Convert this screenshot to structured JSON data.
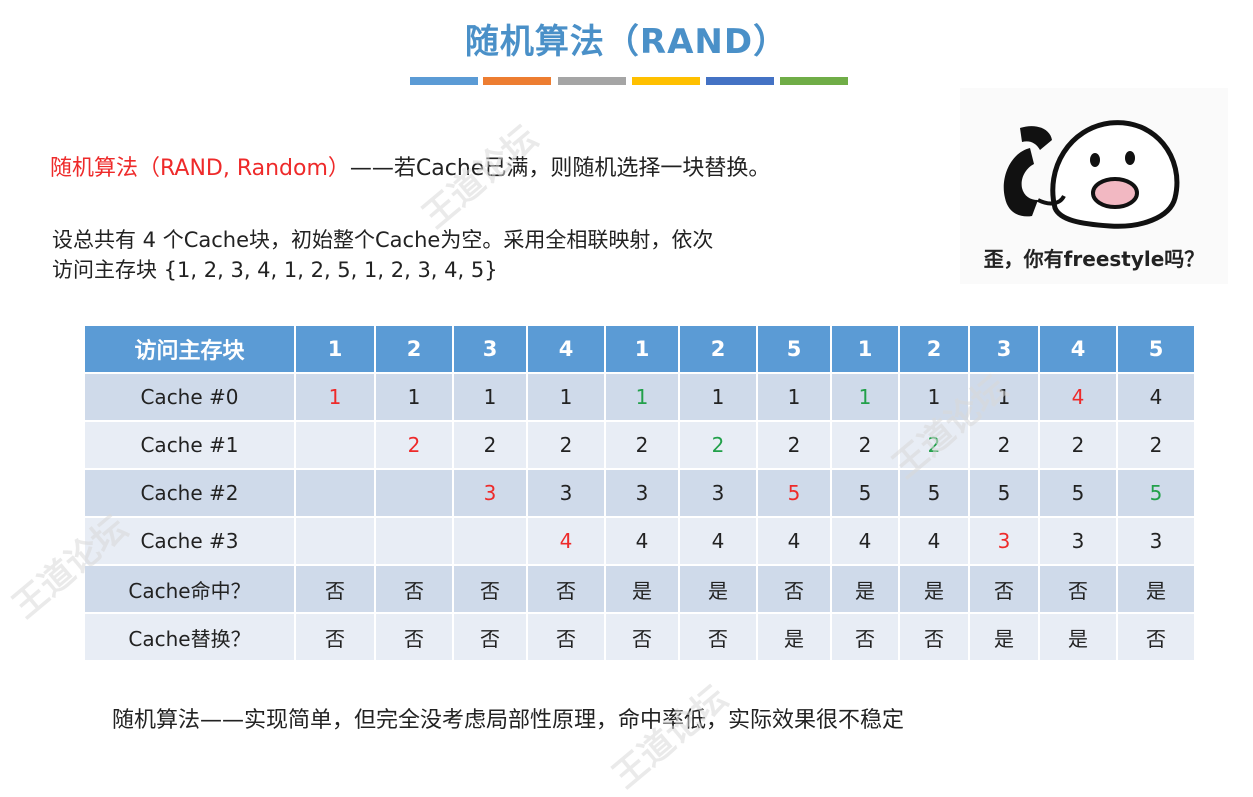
{
  "title": "随机算法（RAND）",
  "color_bar": [
    "#5b9bd5",
    "#ed7d31",
    "#a5a5a5",
    "#ffc000",
    "#4472c4",
    "#70ad47"
  ],
  "definition": {
    "term": "随机算法（RAND, Random）",
    "rest": "——若Cache已满，则随机选择一块替换。"
  },
  "setup": {
    "line1": "设总共有 4 个Cache块，初始整个Cache为空。采用全相联映射，依次",
    "line2": "访问主存块 {1, 2, 3, 4, 1, 2, 5, 1, 2, 3, 4, 5}"
  },
  "meme": {
    "caption": "歪，你有freestyle吗？"
  },
  "table": {
    "header": [
      "访问主存块",
      "1",
      "2",
      "3",
      "4",
      "1",
      "2",
      "5",
      "1",
      "2",
      "3",
      "4",
      "5"
    ],
    "rows": [
      {
        "label": "Cache #0",
        "cells": [
          {
            "v": "1",
            "c": "red"
          },
          {
            "v": "1",
            "c": "black"
          },
          {
            "v": "1",
            "c": "black"
          },
          {
            "v": "1",
            "c": "black"
          },
          {
            "v": "1",
            "c": "green"
          },
          {
            "v": "1",
            "c": "black"
          },
          {
            "v": "1",
            "c": "black"
          },
          {
            "v": "1",
            "c": "green"
          },
          {
            "v": "1",
            "c": "black"
          },
          {
            "v": "1",
            "c": "black"
          },
          {
            "v": "4",
            "c": "red"
          },
          {
            "v": "4",
            "c": "black"
          }
        ]
      },
      {
        "label": "Cache #1",
        "cells": [
          {
            "v": "",
            "c": "black"
          },
          {
            "v": "2",
            "c": "red"
          },
          {
            "v": "2",
            "c": "black"
          },
          {
            "v": "2",
            "c": "black"
          },
          {
            "v": "2",
            "c": "black"
          },
          {
            "v": "2",
            "c": "green"
          },
          {
            "v": "2",
            "c": "black"
          },
          {
            "v": "2",
            "c": "black"
          },
          {
            "v": "2",
            "c": "green"
          },
          {
            "v": "2",
            "c": "black"
          },
          {
            "v": "2",
            "c": "black"
          },
          {
            "v": "2",
            "c": "black"
          }
        ]
      },
      {
        "label": "Cache #2",
        "cells": [
          {
            "v": "",
            "c": "black"
          },
          {
            "v": "",
            "c": "black"
          },
          {
            "v": "3",
            "c": "red"
          },
          {
            "v": "3",
            "c": "black"
          },
          {
            "v": "3",
            "c": "black"
          },
          {
            "v": "3",
            "c": "black"
          },
          {
            "v": "5",
            "c": "red"
          },
          {
            "v": "5",
            "c": "black"
          },
          {
            "v": "5",
            "c": "black"
          },
          {
            "v": "5",
            "c": "black"
          },
          {
            "v": "5",
            "c": "black"
          },
          {
            "v": "5",
            "c": "green"
          }
        ]
      },
      {
        "label": "Cache #3",
        "cells": [
          {
            "v": "",
            "c": "black"
          },
          {
            "v": "",
            "c": "black"
          },
          {
            "v": "",
            "c": "black"
          },
          {
            "v": "4",
            "c": "red"
          },
          {
            "v": "4",
            "c": "black"
          },
          {
            "v": "4",
            "c": "black"
          },
          {
            "v": "4",
            "c": "black"
          },
          {
            "v": "4",
            "c": "black"
          },
          {
            "v": "4",
            "c": "black"
          },
          {
            "v": "3",
            "c": "red"
          },
          {
            "v": "3",
            "c": "black"
          },
          {
            "v": "3",
            "c": "black"
          }
        ]
      },
      {
        "label": "Cache命中？",
        "cells": [
          {
            "v": "否",
            "c": "black"
          },
          {
            "v": "否",
            "c": "black"
          },
          {
            "v": "否",
            "c": "black"
          },
          {
            "v": "否",
            "c": "black"
          },
          {
            "v": "是",
            "c": "black"
          },
          {
            "v": "是",
            "c": "black"
          },
          {
            "v": "否",
            "c": "black"
          },
          {
            "v": "是",
            "c": "black"
          },
          {
            "v": "是",
            "c": "black"
          },
          {
            "v": "否",
            "c": "black"
          },
          {
            "v": "否",
            "c": "black"
          },
          {
            "v": "是",
            "c": "black"
          }
        ]
      },
      {
        "label": "Cache替换？",
        "cells": [
          {
            "v": "否",
            "c": "black"
          },
          {
            "v": "否",
            "c": "black"
          },
          {
            "v": "否",
            "c": "black"
          },
          {
            "v": "否",
            "c": "black"
          },
          {
            "v": "否",
            "c": "black"
          },
          {
            "v": "否",
            "c": "black"
          },
          {
            "v": "是",
            "c": "black"
          },
          {
            "v": "否",
            "c": "black"
          },
          {
            "v": "否",
            "c": "black"
          },
          {
            "v": "是",
            "c": "black"
          },
          {
            "v": "是",
            "c": "black"
          },
          {
            "v": "否",
            "c": "black"
          }
        ]
      }
    ]
  },
  "note": "随机算法——实现简单，但完全没考虑局部性原理，命中率低，实际效果很不稳定",
  "watermark": "王道论坛"
}
